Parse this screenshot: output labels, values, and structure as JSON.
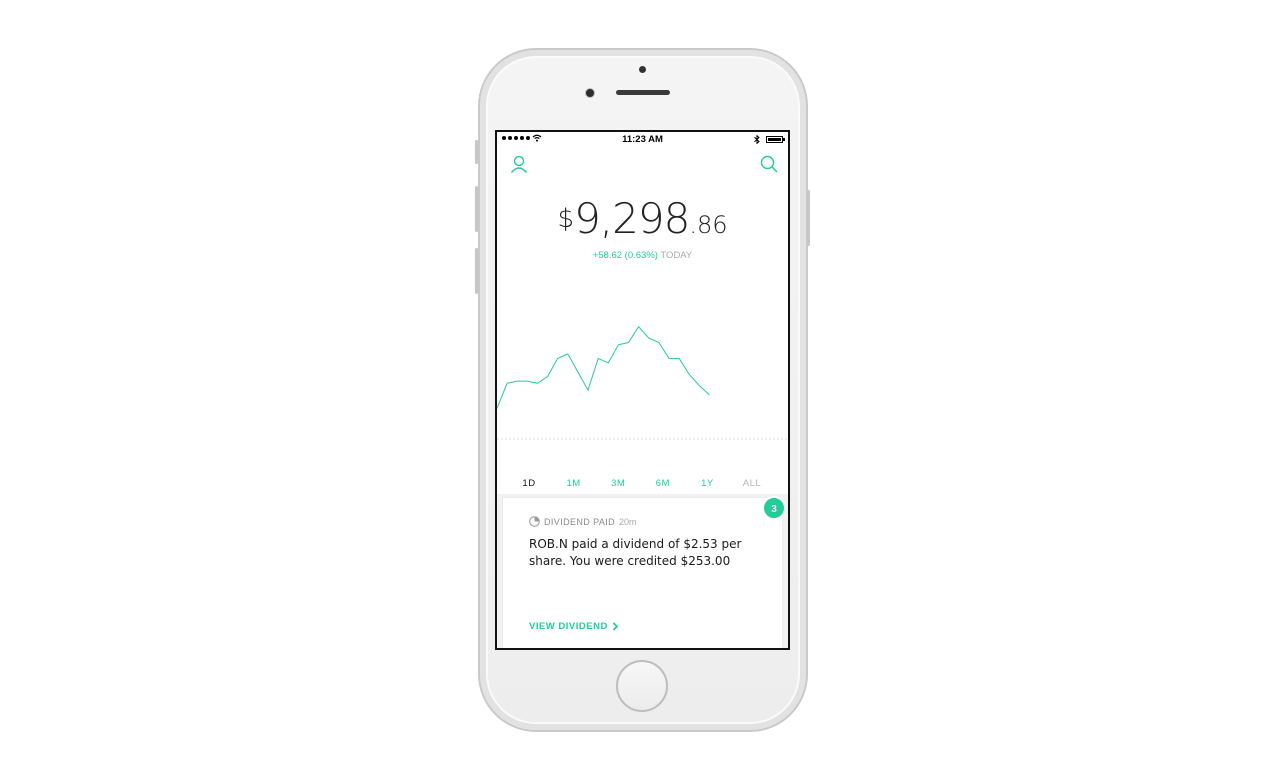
{
  "status_bar": {
    "time": "11:23 AM"
  },
  "header": {
    "profile_icon": "person-outline-icon",
    "search_icon": "search-icon"
  },
  "portfolio": {
    "currency": "$",
    "value_main": "9,298",
    "value_cents": ".86",
    "change": "+58.62 (0.63%)",
    "change_period": "TODAY"
  },
  "chart_data": {
    "type": "line",
    "color": "#21ce99",
    "baseline": "dotted",
    "values": [
      64,
      75,
      76,
      76,
      75,
      78,
      86,
      88,
      80,
      72,
      86,
      84,
      92,
      93,
      100,
      95,
      93,
      86,
      86,
      79,
      74,
      70
    ],
    "note_days_progress": 0.73
  },
  "time_ranges": {
    "items": [
      "1D",
      "1M",
      "3M",
      "6M",
      "1Y",
      "ALL"
    ],
    "active": "1D",
    "disabled": "ALL"
  },
  "notification": {
    "badge_count": "3",
    "title": "DIVIDEND PAID",
    "time": "20m",
    "body": "ROB.N paid a dividend of $2.53 per share. You were credited $253.00",
    "action": "VIEW DIVIDEND"
  },
  "colors": {
    "accent": "#21ce99"
  }
}
